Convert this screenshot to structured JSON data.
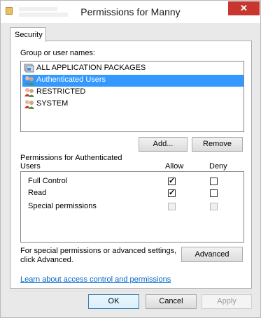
{
  "window": {
    "title": "Permissions for Manny",
    "close_glyph": "✕"
  },
  "tabs": [
    {
      "label": "Security"
    }
  ],
  "groups": {
    "label": "Group or user names:",
    "items": [
      {
        "label": "ALL APPLICATION PACKAGES",
        "icon": "packages-icon",
        "selected": false
      },
      {
        "label": "Authenticated Users",
        "icon": "users-icon",
        "selected": true
      },
      {
        "label": "RESTRICTED",
        "icon": "users-icon",
        "selected": false
      },
      {
        "label": "SYSTEM",
        "icon": "users-icon",
        "selected": false
      }
    ],
    "add_label": "Add...",
    "remove_label": "Remove"
  },
  "permissions": {
    "header_line1": "Permissions for Authenticated",
    "header_line2": "Users",
    "allow_label": "Allow",
    "deny_label": "Deny",
    "rows": [
      {
        "label": "Full Control",
        "allow": true,
        "deny": false,
        "disabled": false
      },
      {
        "label": "Read",
        "allow": true,
        "deny": false,
        "disabled": false
      },
      {
        "label": "Special permissions",
        "allow": false,
        "deny": false,
        "disabled": true
      }
    ]
  },
  "advanced": {
    "text_line1": "For special permissions or advanced settings,",
    "text_line2": "click Advanced.",
    "button_label": "Advanced"
  },
  "learn_link": "Learn about access control and permissions",
  "footer": {
    "ok_label": "OK",
    "cancel_label": "Cancel",
    "apply_label": "Apply"
  }
}
